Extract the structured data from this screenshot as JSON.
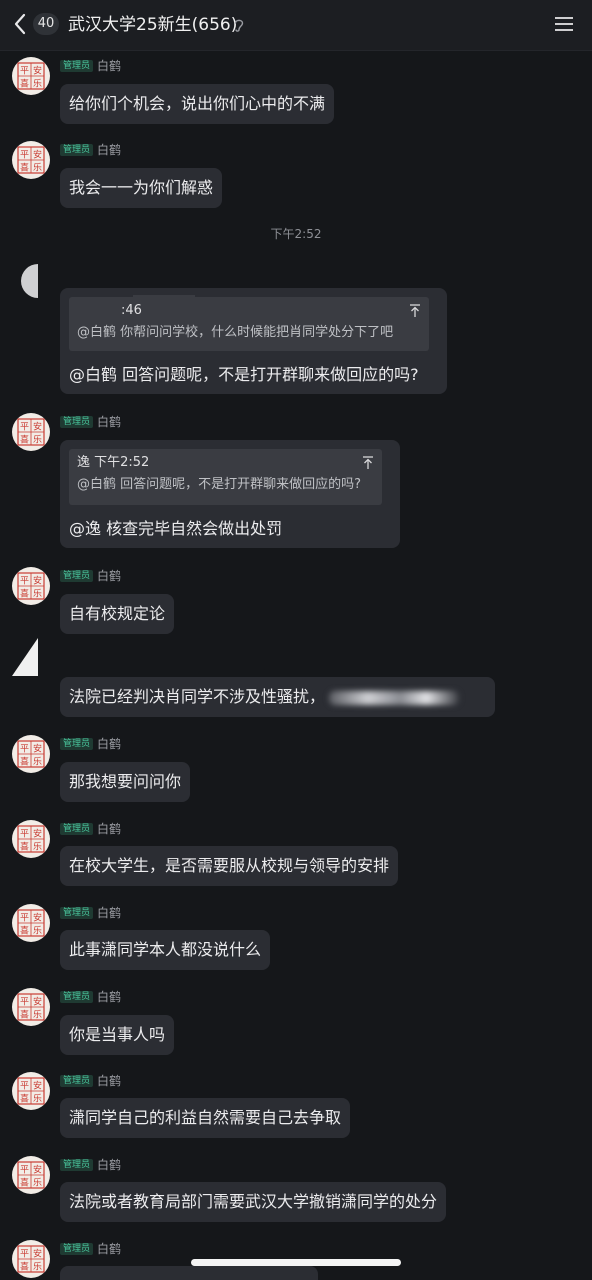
{
  "header": {
    "unread_count": "40",
    "title": "武汉大学25新生(656)"
  },
  "timestamp": "下午2:52",
  "messages": [
    {
      "role": "管理员",
      "sender": "白鹤",
      "text": "给你们个机会，说出你们心中的不满"
    },
    {
      "role": "管理员",
      "sender": "白鹤",
      "text": "我会一一为你们解惑"
    },
    {
      "quote_time": ":46",
      "quote_text": "@白鹤 你帮问问学校，什么时候能把肖同学处分下了吧",
      "text": "@白鹤 回答问题呢，不是打开群聊来做回应的吗?"
    },
    {
      "role": "管理员",
      "sender": "白鹤",
      "quote_time": "逸 下午2:52",
      "quote_text": "@白鹤 回答问题呢，不是打开群聊来做回应的吗?",
      "text": "@逸 核查完毕自然会做出处罚"
    },
    {
      "role": "管理员",
      "sender": "白鹤",
      "text": "自有校规定论"
    },
    {
      "text": "法院已经判决肖同学不涉及性骚扰，"
    },
    {
      "role": "管理员",
      "sender": "白鹤",
      "text": "那我想要问问你"
    },
    {
      "role": "管理员",
      "sender": "白鹤",
      "text": "在校大学生，是否需要服从校规与领导的安排"
    },
    {
      "role": "管理员",
      "sender": "白鹤",
      "text": "此事潇同学本人都没说什么"
    },
    {
      "role": "管理员",
      "sender": "白鹤",
      "text": "你是当事人吗"
    },
    {
      "role": "管理员",
      "sender": "白鹤",
      "text": "潇同学自己的利益自然需要自己去争取"
    },
    {
      "role": "管理员",
      "sender": "白鹤",
      "text": "法院或者教育局部门需要武汉大学撤销潇同学的处分"
    },
    {
      "role": "管理员",
      "sender": "白鹤",
      "text": ""
    }
  ],
  "avatar_text": [
    "平",
    "安",
    "喜",
    "乐"
  ]
}
